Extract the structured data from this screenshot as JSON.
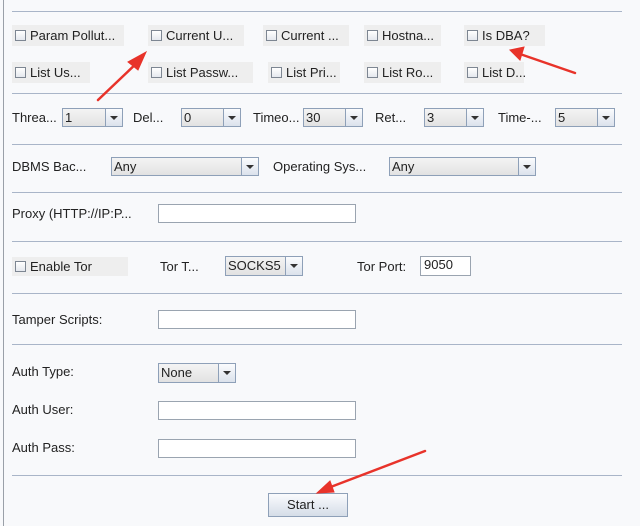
{
  "checkboxes_row1": [
    "Param Pollut...",
    "Current U...",
    "Current ...",
    "Hostna...",
    "Is DBA?"
  ],
  "checkboxes_row2": [
    "List Us...",
    "List Passw...",
    "List Pri...",
    "List Ro...",
    "List D..."
  ],
  "request": {
    "threads_label": "Threa...",
    "threads": "1",
    "delay_label": "Del...",
    "delay": "0",
    "timeout_label": "Timeo...",
    "timeout": "30",
    "retries_label": "Ret...",
    "retries": "3",
    "timesec_label": "Time-...",
    "timesec": "5"
  },
  "dbms": {
    "label": "DBMS Bac...",
    "value": "Any",
    "os_label": "Operating Sys...",
    "os_value": "Any"
  },
  "proxy": {
    "label": "Proxy (HTTP://IP:P...",
    "value": ""
  },
  "tor": {
    "enable_label": "Enable Tor",
    "type_label": "Tor T...",
    "type": "SOCKS5",
    "port_label": "Tor Port:",
    "port": "9050"
  },
  "tamper": {
    "label": "Tamper Scripts:",
    "value": ""
  },
  "auth": {
    "type_label": "Auth Type:",
    "type": "None",
    "user_label": "Auth User:",
    "user": "",
    "pass_label": "Auth Pass:",
    "pass": ""
  },
  "start_label": "Start ...",
  "colors": {
    "annotation_arrow": "#e8332a"
  }
}
